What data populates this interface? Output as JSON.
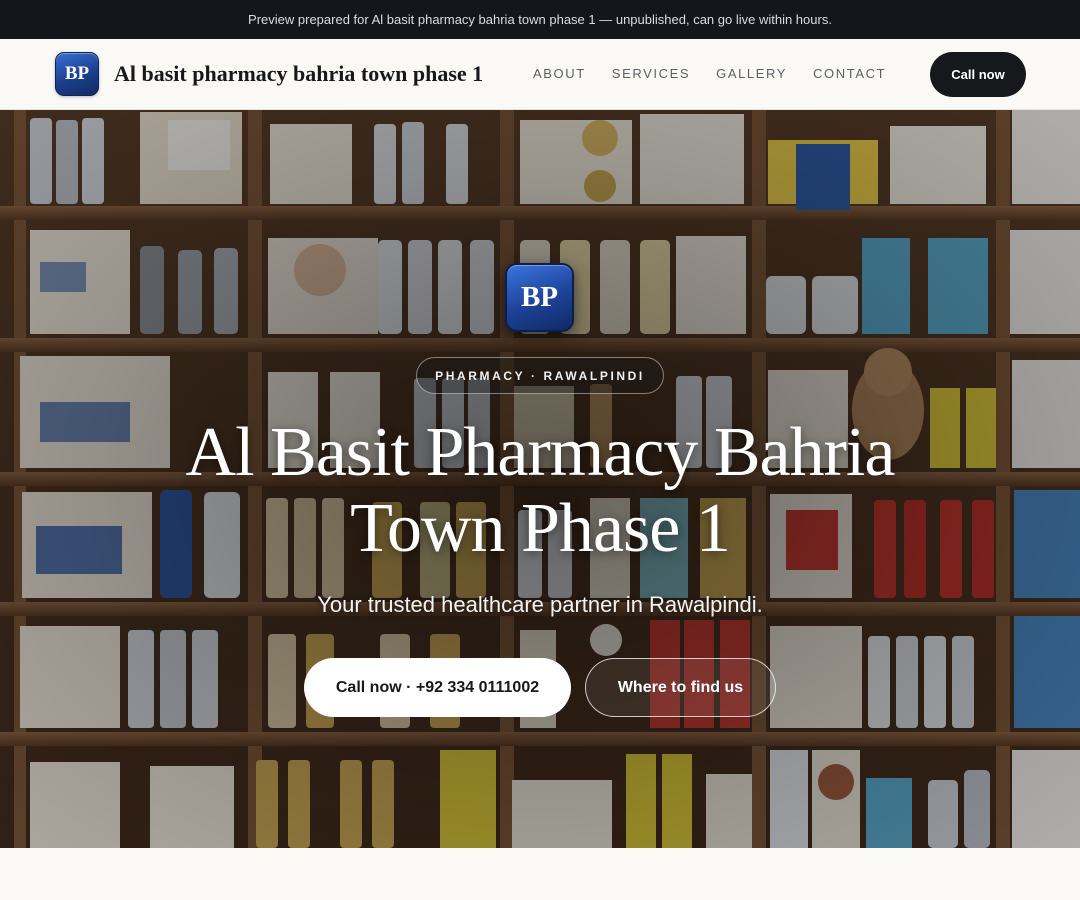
{
  "announcement": "Preview prepared for Al basit pharmacy bahria town phase 1 — unpublished, can go live within hours.",
  "header": {
    "logo_initials": "BP",
    "brand_name": "Al basit pharmacy bahria town phase 1",
    "nav": [
      "ABOUT",
      "SERVICES",
      "GALLERY",
      "CONTACT"
    ],
    "cta": "Call now"
  },
  "hero": {
    "logo_initials": "BP",
    "eyebrow": "PHARMACY · RAWALPINDI",
    "title_line1": "Al Basit Pharmacy Bahria",
    "title_line2": "Town Phase 1",
    "subtitle": "Your trusted healthcare partner in Rawalpindi.",
    "primary_cta": "Call now · +92 334 0111002",
    "secondary_cta": "Where to find us"
  },
  "colors": {
    "topbar_bg": "#13161b",
    "dark_button": "#16181c",
    "badge_blue": "#1c4297"
  },
  "icons": {
    "hero_background": "pharmacy-shelves-photo"
  }
}
